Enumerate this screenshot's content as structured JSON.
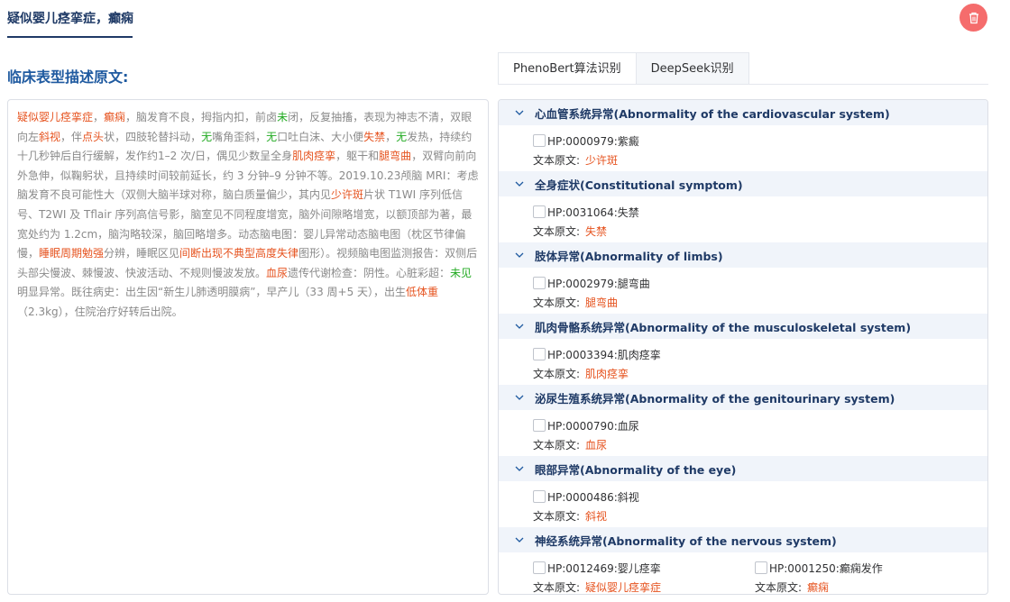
{
  "header": {
    "tab_title": "疑似婴儿痉挛症，癫痫",
    "delete_label": "delete"
  },
  "left": {
    "title": "临床表型描述原文:",
    "segments": [
      {
        "t": "疑似婴儿痉挛症",
        "c": "o"
      },
      {
        "t": "，",
        "c": ""
      },
      {
        "t": "癫痫",
        "c": "o"
      },
      {
        "t": "，脑发育不良，拇指内扣，前卤",
        "c": ""
      },
      {
        "t": "未",
        "c": "g"
      },
      {
        "t": "闭，反复抽搐，表现为神志不清，双眼向左",
        "c": ""
      },
      {
        "t": "斜视",
        "c": "o"
      },
      {
        "t": "，伴",
        "c": ""
      },
      {
        "t": "点头",
        "c": "o"
      },
      {
        "t": "状，四肢轮替抖动，",
        "c": ""
      },
      {
        "t": "无",
        "c": "g"
      },
      {
        "t": "嘴角歪斜，",
        "c": ""
      },
      {
        "t": "无",
        "c": "g"
      },
      {
        "t": "口吐白沫、大小便",
        "c": ""
      },
      {
        "t": "失禁",
        "c": "o"
      },
      {
        "t": "，",
        "c": ""
      },
      {
        "t": "无",
        "c": "g"
      },
      {
        "t": "发热，持续约十几秒钟后自行缓解，发作约1–2 次/日，偶见少数呈全身",
        "c": ""
      },
      {
        "t": "肌肉痉挛",
        "c": "o"
      },
      {
        "t": "，躯干和",
        "c": ""
      },
      {
        "t": "腿弯曲",
        "c": "o"
      },
      {
        "t": "，双臂向前向外急伸，似鞠躬状，且持续时间较前延长，约 3 分钟–9 分钟不等。2019.10.23颅脑 MRI：考虑脑发育不良可能性大（双侧大脑半球对称，脑白质量偏少，其内见",
        "c": ""
      },
      {
        "t": "少许斑",
        "c": "o"
      },
      {
        "t": "片状 T1WI 序列低信号、T2WI 及 Tflair 序列高信号影，脑室见不同程度增宽，脑外间隙略增宽，以额顶部为著，最宽处约为 1.2cm，脑沟略较深，脑回略增多。动态脑电图：婴儿异常动态脑电图（枕区节律偏慢，",
        "c": ""
      },
      {
        "t": "睡眠周期勉强",
        "c": "o"
      },
      {
        "t": "分辨，睡眠区见",
        "c": ""
      },
      {
        "t": "间断出现不典型高度失律",
        "c": "o"
      },
      {
        "t": "图形）。视频脑电图监测报告：双侧后头部尖慢波、棘慢波、快波活动、不规则慢波发放。",
        "c": ""
      },
      {
        "t": "血尿",
        "c": "o"
      },
      {
        "t": "遗传代谢检查：阴性。心脏彩超：",
        "c": ""
      },
      {
        "t": "未见",
        "c": "g"
      },
      {
        "t": "明显异常。既往病史：出生因“新生儿肺透明膜病”，早产儿（33 周+5 天），出生",
        "c": ""
      },
      {
        "t": "低体重",
        "c": "o"
      },
      {
        "t": "（2.3kg），住院治疗好转后出院。",
        "c": ""
      }
    ]
  },
  "right": {
    "tabs": [
      {
        "label": "PhenoBert算法识别",
        "active": true
      },
      {
        "label": "DeepSeek识别",
        "active": false
      }
    ],
    "source_label": "文本原文:",
    "categories": [
      {
        "name": "心血管系统异常(Abnormality of the cardiovascular system)",
        "items": [
          {
            "hp": "HP:0000979:紫癜",
            "src": "少许斑"
          }
        ]
      },
      {
        "name": "全身症状(Constitutional symptom)",
        "items": [
          {
            "hp": "HP:0031064:失禁",
            "src": "失禁"
          }
        ]
      },
      {
        "name": "肢体异常(Abnormality of limbs)",
        "items": [
          {
            "hp": "HP:0002979:腿弯曲",
            "src": "腿弯曲"
          }
        ]
      },
      {
        "name": "肌肉骨骼系统异常(Abnormality of the musculoskeletal system)",
        "items": [
          {
            "hp": "HP:0003394:肌肉痉挛",
            "src": "肌肉痉挛"
          }
        ]
      },
      {
        "name": "泌尿生殖系统异常(Abnormality of the genitourinary system)",
        "items": [
          {
            "hp": "HP:0000790:血尿",
            "src": "血尿"
          }
        ]
      },
      {
        "name": "眼部异常(Abnormality of the eye)",
        "items": [
          {
            "hp": "HP:0000486:斜视",
            "src": "斜视"
          }
        ]
      },
      {
        "name": "神经系统异常(Abnormality of the nervous system)",
        "items": [
          {
            "hp": "HP:0012469:婴儿痉挛",
            "src": "疑似婴儿痉挛症"
          },
          {
            "hp": "HP:0001250:癫痫发作",
            "src": "癫痫"
          }
        ]
      }
    ]
  },
  "colors": {
    "accent": "#1f3a66",
    "highlight": "#e6531f",
    "negation": "#22aa22",
    "danger": "#f56c6c"
  }
}
